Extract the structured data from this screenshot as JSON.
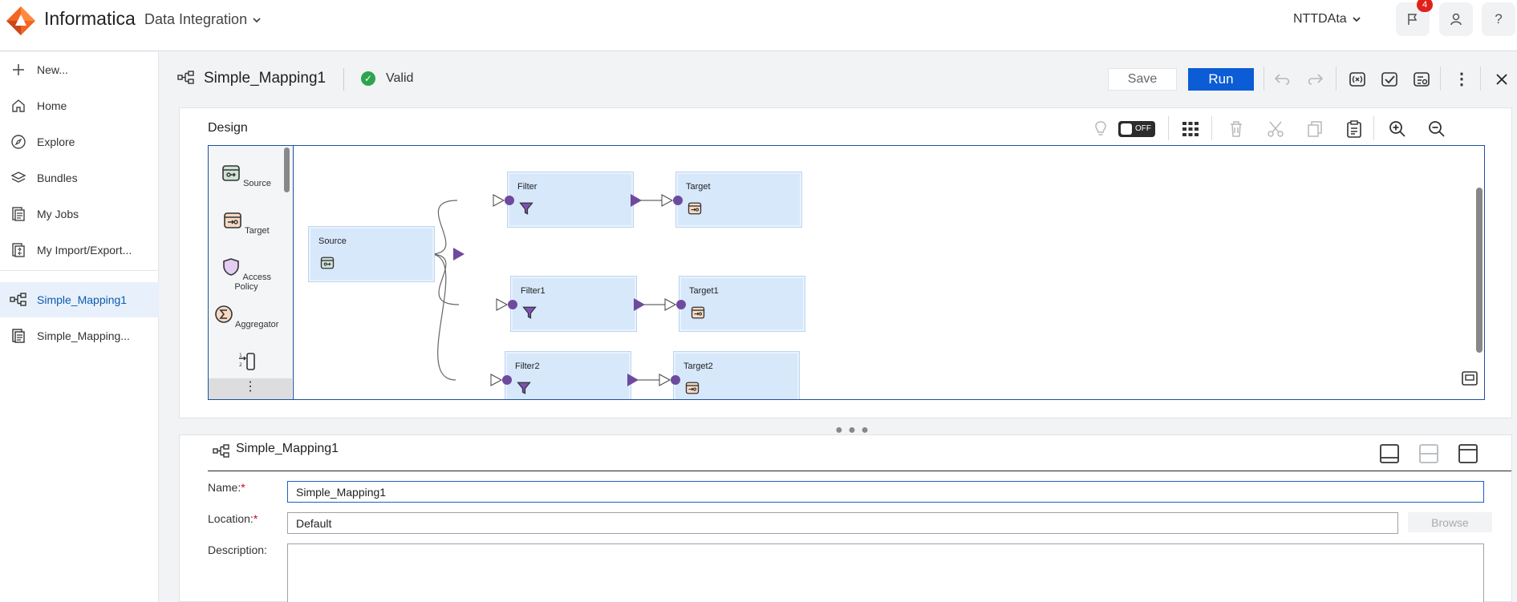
{
  "topbar": {
    "brand": "Informatica",
    "product": "Data Integration",
    "org": "NTTDAta",
    "notifications_count": "4"
  },
  "leftnav": {
    "items": [
      {
        "label": "New...",
        "icon": "plus-icon"
      },
      {
        "label": "Home",
        "icon": "home-icon"
      },
      {
        "label": "Explore",
        "icon": "compass-icon"
      },
      {
        "label": "Bundles",
        "icon": "layers-icon"
      },
      {
        "label": "My Jobs",
        "icon": "jobs-icon"
      },
      {
        "label": "My Import/Export...",
        "icon": "import-export-icon"
      }
    ],
    "open_tabs": [
      {
        "label": "Simple_Mapping1",
        "icon": "mapping-icon",
        "active": true
      },
      {
        "label": "Simple_Mapping...",
        "icon": "document-icon",
        "active": false
      }
    ]
  },
  "header": {
    "title": "Simple_Mapping1",
    "status": "Valid",
    "save_label": "Save",
    "run_label": "Run"
  },
  "design": {
    "title": "Design",
    "recommendations_toggle": "OFF",
    "palette": [
      {
        "label": "Source",
        "icon": "source-icon"
      },
      {
        "label": "Target",
        "icon": "target-icon"
      },
      {
        "label": "Access Policy",
        "icon": "shield-icon"
      },
      {
        "label": "Aggregator",
        "icon": "sigma-icon"
      }
    ],
    "nodes": [
      {
        "label": "Source",
        "icon": "source-icon"
      },
      {
        "label": "Filter",
        "icon": "funnel-icon"
      },
      {
        "label": "Target",
        "icon": "target-icon"
      },
      {
        "label": "Filter1",
        "icon": "funnel-icon"
      },
      {
        "label": "Target1",
        "icon": "target-icon"
      },
      {
        "label": "Filter2",
        "icon": "funnel-icon"
      },
      {
        "label": "Target2",
        "icon": "target-icon"
      }
    ]
  },
  "properties": {
    "title": "Simple_Mapping1",
    "name_label": "Name:",
    "name_value": "Simple_Mapping1",
    "location_label": "Location:",
    "location_value": "Default",
    "browse_label": "Browse",
    "description_label": "Description:",
    "description_value": "",
    "required_mark": "*"
  },
  "colors": {
    "accent": "#0b5cd5",
    "node_fill": "#d7e8fb",
    "port": "#6e4a9e",
    "valid": "#2ea44f",
    "badge": "#e0211b"
  }
}
